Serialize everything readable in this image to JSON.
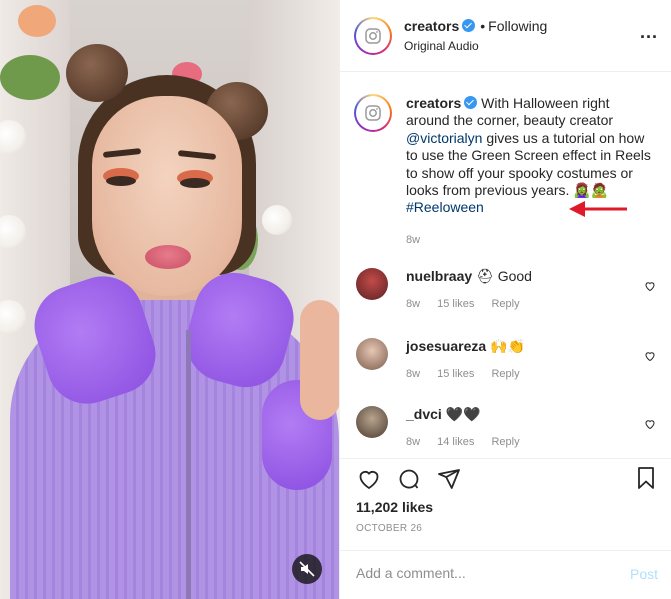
{
  "header": {
    "username": "creators",
    "separator": "•",
    "follow_status": "Following",
    "audio": "Original Audio",
    "more_label": "..."
  },
  "caption": {
    "username": "creators",
    "text_1": "With Halloween right around the corner, beauty creator",
    "mention": "@victorialyn",
    "text_2": "gives us a tutorial on how to use the Green Screen effect in Reels to show off your spooky costumes or looks from previous years.",
    "emojis": "🧟‍♀️🧟",
    "hashtag": "#Reeloween",
    "time": "8w"
  },
  "comments": [
    {
      "username": "nuelbraay",
      "text": "⛑ Good",
      "time": "8w",
      "likes": "15 likes",
      "reply": "Reply"
    },
    {
      "username": "josesuareza",
      "text": "🙌👏",
      "time": "8w",
      "likes": "15 likes",
      "reply": "Reply"
    },
    {
      "username": "_dvci",
      "text": "🖤🖤",
      "time": "8w",
      "likes": "14 likes",
      "reply": "Reply"
    }
  ],
  "footer": {
    "likes": "11,202 likes",
    "date": "OCTOBER 26",
    "comment_placeholder": "Add a comment...",
    "post_label": "Post"
  },
  "colors": {
    "verified": "#3897f0",
    "link": "#00376b",
    "annotation_arrow": "#e0192a",
    "post_disabled": "#b2dffc"
  },
  "icons": [
    "instagram-logo-icon",
    "verified-badge-icon",
    "more-icon",
    "heart-icon",
    "comment-icon",
    "share-icon",
    "bookmark-icon",
    "mute-icon",
    "arrow-annotation-icon"
  ]
}
